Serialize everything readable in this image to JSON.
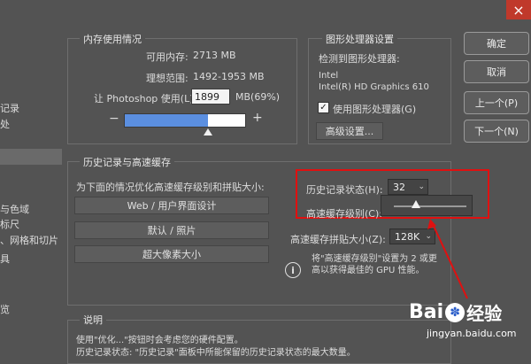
{
  "close_glyph": "×",
  "sidebar": {
    "items": [
      {
        "label": "记录"
      },
      {
        "label": "处"
      },
      {
        "label": "与色域"
      },
      {
        "label": "标尺"
      },
      {
        "label": "、网格和切片"
      },
      {
        "label": "具"
      },
      {
        "label": "览"
      }
    ]
  },
  "memory": {
    "legend": "内存使用情况",
    "available_label": "可用内存:",
    "available_value": "2713 MB",
    "ideal_label": "理想范围:",
    "ideal_value": "1492-1953 MB",
    "let_label": "让 Photoshop 使用(L):",
    "let_value": "1899",
    "let_unit": "MB(69%)",
    "minus": "−",
    "plus": "+",
    "slider_fraction": 0.69
  },
  "gpu": {
    "legend": "图形处理器设置",
    "detected_label": "检测到图形处理器:",
    "vendor": "Intel",
    "model": "Intel(R) HD Graphics 610",
    "use_gpu_label": "使用图形处理器(G)",
    "use_gpu_checked": true,
    "advanced_button": "高级设置..."
  },
  "right_buttons": {
    "ok": "确定",
    "cancel": "取消",
    "prev": "上一个(P)",
    "next": "下一个(N)"
  },
  "history": {
    "legend": "历史记录与高速缓存",
    "optimize_label": "为下面的情况优化高速缓存级别和拼贴大小:",
    "preset_buttons": [
      {
        "label": "Web / 用户界面设计"
      },
      {
        "label": "默认 / 照片"
      },
      {
        "label": "超大像素大小"
      }
    ],
    "states_label": "历史记录状态(H):",
    "states_value": "32",
    "cache_levels_label": "高速缓存级别(C):",
    "tile_size_label": "高速缓存拼贴大小(Z):",
    "tile_size_value": "128K",
    "info_text": "将\"高速缓存级别\"设置为 2 或更高以获得最佳的 GPU 性能。"
  },
  "desc": {
    "legend": "说明",
    "line1": "使用\"优化...\"按钮时会考虑您的硬件配置。",
    "line2": "历史记录状态: \"历史记录\"面板中所能保留的历史记录状态的最大数量。"
  },
  "watermark": {
    "brand": "Bai",
    "brand2": "经验",
    "url": "jingyan.baidu.com"
  },
  "colors": {
    "highlight_box": "#e01010",
    "slider_fill": "#5b8fe0"
  }
}
